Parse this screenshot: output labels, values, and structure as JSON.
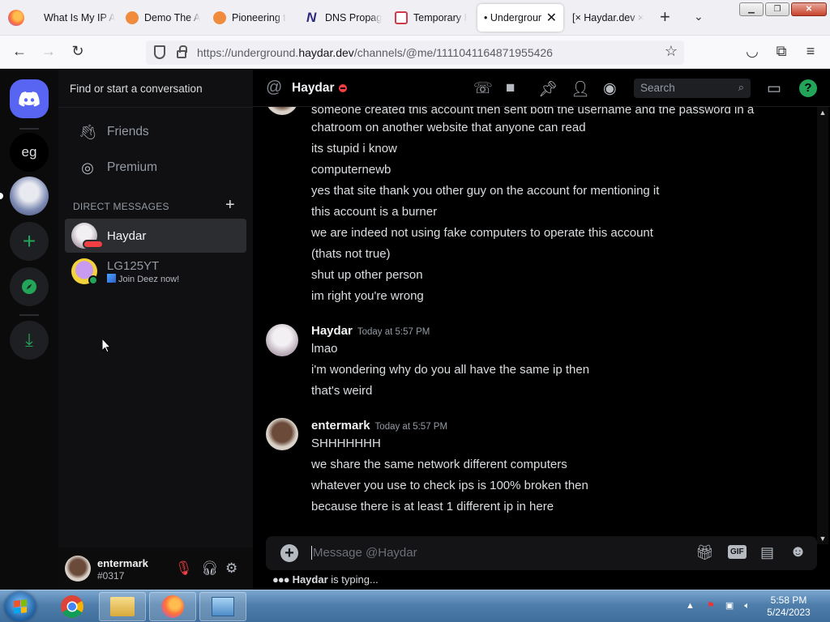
{
  "browser": {
    "tabs": [
      {
        "title": "What Is My IP A",
        "color": "#cfd8e6"
      },
      {
        "title": "Demo The A",
        "color": "#f08a3c"
      },
      {
        "title": "Pioneering t",
        "color": "#f08a3c"
      },
      {
        "title": "DNS Propag",
        "color": "#2d2a7d"
      },
      {
        "title": "Temporary I",
        "color": "#d03a4a"
      },
      {
        "title": "• Undergroun",
        "active": true
      },
      {
        "title": "[× Haydar.dev ×"
      }
    ],
    "new_tab": "+",
    "tab_list": "⌄",
    "url_prefix": "https://underground.",
    "url_domain": "haydar.dev",
    "url_suffix": "/channels/@me/1111041164871955426"
  },
  "discord": {
    "server_text": "eg",
    "search_conversation": "Find or start a conversation",
    "nav": [
      {
        "label": "Friends",
        "icon": "friends-icon"
      },
      {
        "label": "Premium",
        "icon": "nitro-icon"
      }
    ],
    "dm_header": "DIRECT MESSAGES",
    "dms": [
      {
        "name": "Haydar",
        "status": "dnd",
        "active": true,
        "sub": ""
      },
      {
        "name": "LG125YT",
        "status": "online",
        "active": false,
        "sub": "Join Deez now!"
      }
    ],
    "user": {
      "name": "entermark",
      "tag": "#0317"
    },
    "channel": {
      "name": "Haydar",
      "search_placeholder": "Search",
      "help": "?"
    },
    "messages": [
      {
        "lines": [
          "someone created this account then sent both the username and the password in a",
          "chatroom on another website that anyone can read",
          "its stupid i know",
          "computernewb",
          "yes that site thank you other guy on the account for mentioning it",
          "this account is a burner",
          "we are indeed not using fake computers to operate this account",
          "(thats not true)",
          "shut up other person",
          "im right you're wrong"
        ]
      },
      {
        "author": "Haydar",
        "time": "Today at 5:57 PM",
        "lines": [
          "lmao",
          "i'm wondering why do you all have the same ip then",
          "that's weird"
        ]
      },
      {
        "author": "entermark",
        "time": "Today at 5:57 PM",
        "lines": [
          "SHHHHHHH",
          "we share the same network different computers",
          "whatever you use to check ips is 100% broken then",
          "because there is at least 1 different ip in here"
        ]
      }
    ],
    "composer_placeholder": "Message @Haydar",
    "gif_label": "GIF",
    "typing_user": "Haydar",
    "typing_text": "is typing..."
  },
  "taskbar": {
    "time": "5:58 PM",
    "date": "5/24/2023"
  },
  "colors": {
    "blurple": "#5865f2",
    "dnd": "#f23f43",
    "online": "#23a559"
  }
}
